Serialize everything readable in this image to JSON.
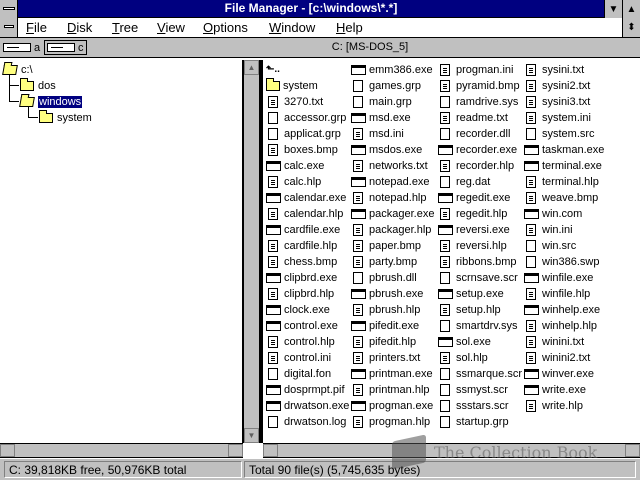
{
  "window": {
    "title": "File Manager - [c:\\windows\\*.*]"
  },
  "title_buttons": {
    "minimize": "▼",
    "maximize": "▲",
    "restore": "⬍"
  },
  "menu": [
    {
      "label": "File",
      "accel": "F",
      "rest": "ile"
    },
    {
      "label": "Disk",
      "accel": "D",
      "rest": "isk"
    },
    {
      "label": "Tree",
      "accel": "T",
      "rest": "ree"
    },
    {
      "label": "View",
      "accel": "V",
      "rest": "iew"
    },
    {
      "label": "Options",
      "accel": "O",
      "rest": "ptions"
    },
    {
      "label": "Window",
      "accel": "W",
      "rest": "indow"
    },
    {
      "label": "Help",
      "accel": "H",
      "rest": "elp"
    }
  ],
  "drives": [
    {
      "letter": "a",
      "selected": false
    },
    {
      "letter": "c",
      "selected": true
    }
  ],
  "volume_label": "C: [MS-DOS_5]",
  "tree": [
    {
      "label": "c:\\",
      "level": 0,
      "selected": false,
      "open": true
    },
    {
      "label": "dos",
      "level": 1,
      "selected": false,
      "open": false
    },
    {
      "label": "windows",
      "level": 1,
      "selected": true,
      "open": true
    },
    {
      "label": "system",
      "level": 2,
      "selected": false,
      "open": false
    }
  ],
  "files": {
    "col1": [
      {
        "name": "",
        "icon": "up"
      },
      {
        "name": "system",
        "icon": "folder"
      },
      {
        "name": "3270.txt",
        "icon": "doc"
      },
      {
        "name": "accessor.grp",
        "icon": "file"
      },
      {
        "name": "applicat.grp",
        "icon": "file"
      },
      {
        "name": "boxes.bmp",
        "icon": "doc"
      },
      {
        "name": "calc.exe",
        "icon": "prog"
      },
      {
        "name": "calc.hlp",
        "icon": "doc"
      },
      {
        "name": "calendar.exe",
        "icon": "prog"
      },
      {
        "name": "calendar.hlp",
        "icon": "doc"
      },
      {
        "name": "cardfile.exe",
        "icon": "prog"
      },
      {
        "name": "cardfile.hlp",
        "icon": "doc"
      },
      {
        "name": "chess.bmp",
        "icon": "doc"
      },
      {
        "name": "clipbrd.exe",
        "icon": "prog"
      },
      {
        "name": "clipbrd.hlp",
        "icon": "doc"
      },
      {
        "name": "clock.exe",
        "icon": "prog"
      },
      {
        "name": "control.exe",
        "icon": "prog"
      },
      {
        "name": "control.hlp",
        "icon": "doc"
      },
      {
        "name": "control.ini",
        "icon": "doc"
      },
      {
        "name": "digital.fon",
        "icon": "file"
      },
      {
        "name": "dosprmpt.pif",
        "icon": "prog"
      },
      {
        "name": "drwatson.exe",
        "icon": "prog"
      },
      {
        "name": "drwatson.log",
        "icon": "file"
      }
    ],
    "col2": [
      {
        "name": "emm386.exe",
        "icon": "prog"
      },
      {
        "name": "games.grp",
        "icon": "file"
      },
      {
        "name": "main.grp",
        "icon": "file"
      },
      {
        "name": "msd.exe",
        "icon": "prog"
      },
      {
        "name": "msd.ini",
        "icon": "doc"
      },
      {
        "name": "msdos.exe",
        "icon": "prog"
      },
      {
        "name": "networks.txt",
        "icon": "doc"
      },
      {
        "name": "notepad.exe",
        "icon": "prog"
      },
      {
        "name": "notepad.hlp",
        "icon": "doc"
      },
      {
        "name": "packager.exe",
        "icon": "prog"
      },
      {
        "name": "packager.hlp",
        "icon": "doc"
      },
      {
        "name": "paper.bmp",
        "icon": "doc"
      },
      {
        "name": "party.bmp",
        "icon": "doc"
      },
      {
        "name": "pbrush.dll",
        "icon": "file"
      },
      {
        "name": "pbrush.exe",
        "icon": "prog"
      },
      {
        "name": "pbrush.hlp",
        "icon": "doc"
      },
      {
        "name": "pifedit.exe",
        "icon": "prog"
      },
      {
        "name": "pifedit.hlp",
        "icon": "doc"
      },
      {
        "name": "printers.txt",
        "icon": "doc"
      },
      {
        "name": "printman.exe",
        "icon": "prog"
      },
      {
        "name": "printman.hlp",
        "icon": "doc"
      },
      {
        "name": "progman.exe",
        "icon": "prog"
      },
      {
        "name": "progman.hlp",
        "icon": "doc"
      }
    ],
    "col3": [
      {
        "name": "progman.ini",
        "icon": "doc"
      },
      {
        "name": "pyramid.bmp",
        "icon": "doc"
      },
      {
        "name": "ramdrive.sys",
        "icon": "file"
      },
      {
        "name": "readme.txt",
        "icon": "doc"
      },
      {
        "name": "recorder.dll",
        "icon": "file"
      },
      {
        "name": "recorder.exe",
        "icon": "prog"
      },
      {
        "name": "recorder.hlp",
        "icon": "doc"
      },
      {
        "name": "reg.dat",
        "icon": "file"
      },
      {
        "name": "regedit.exe",
        "icon": "prog"
      },
      {
        "name": "regedit.hlp",
        "icon": "doc"
      },
      {
        "name": "reversi.exe",
        "icon": "prog"
      },
      {
        "name": "reversi.hlp",
        "icon": "doc"
      },
      {
        "name": "ribbons.bmp",
        "icon": "doc"
      },
      {
        "name": "scrnsave.scr",
        "icon": "file"
      },
      {
        "name": "setup.exe",
        "icon": "prog"
      },
      {
        "name": "setup.hlp",
        "icon": "doc"
      },
      {
        "name": "smartdrv.sys",
        "icon": "file"
      },
      {
        "name": "sol.exe",
        "icon": "prog"
      },
      {
        "name": "sol.hlp",
        "icon": "doc"
      },
      {
        "name": "ssmarque.scr",
        "icon": "file"
      },
      {
        "name": "ssmyst.scr",
        "icon": "file"
      },
      {
        "name": "ssstars.scr",
        "icon": "file"
      },
      {
        "name": "startup.grp",
        "icon": "file"
      }
    ],
    "col4": [
      {
        "name": "sysini.txt",
        "icon": "doc"
      },
      {
        "name": "sysini2.txt",
        "icon": "doc"
      },
      {
        "name": "sysini3.txt",
        "icon": "doc"
      },
      {
        "name": "system.ini",
        "icon": "doc"
      },
      {
        "name": "system.src",
        "icon": "file"
      },
      {
        "name": "taskman.exe",
        "icon": "prog"
      },
      {
        "name": "terminal.exe",
        "icon": "prog"
      },
      {
        "name": "terminal.hlp",
        "icon": "doc"
      },
      {
        "name": "weave.bmp",
        "icon": "doc"
      },
      {
        "name": "win.com",
        "icon": "prog"
      },
      {
        "name": "win.ini",
        "icon": "doc"
      },
      {
        "name": "win.src",
        "icon": "file"
      },
      {
        "name": "win386.swp",
        "icon": "file"
      },
      {
        "name": "winfile.exe",
        "icon": "prog"
      },
      {
        "name": "winfile.hlp",
        "icon": "doc"
      },
      {
        "name": "winhelp.exe",
        "icon": "prog"
      },
      {
        "name": "winhelp.hlp",
        "icon": "doc"
      },
      {
        "name": "winini.txt",
        "icon": "doc"
      },
      {
        "name": "winini2.txt",
        "icon": "doc"
      },
      {
        "name": "winver.exe",
        "icon": "prog"
      },
      {
        "name": "write.exe",
        "icon": "prog"
      },
      {
        "name": "write.hlp",
        "icon": "doc"
      }
    ]
  },
  "status": {
    "disk": "C: 39,818KB free,  50,976KB total",
    "files": "Total 90 file(s) (5,745,635 bytes)"
  },
  "watermark": "The Collection Book",
  "colors": {
    "title_bar": "#000080",
    "selection": "#000080",
    "chrome": "#c0c0c0"
  }
}
